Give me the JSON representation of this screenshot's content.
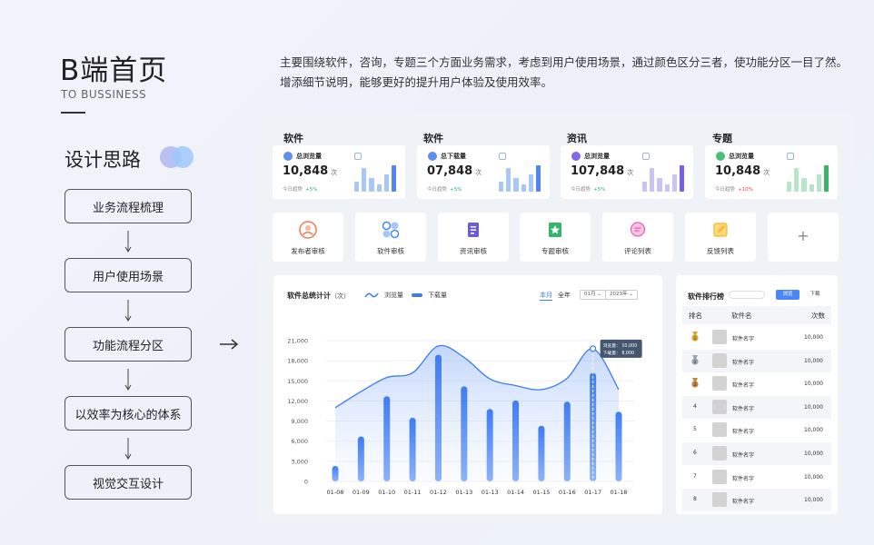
{
  "header": {
    "title": "B端首页",
    "subtitle": "TO BUSSINESS",
    "intro": "主要围绕软件，咨询，专题三个方面业务需求，考虑到用户使用场景，通过颜色区分三者，使功能分区一目了然。增添细节说明，能够更好的提升用户体验及使用效率。"
  },
  "flow": {
    "title": "设计思路",
    "steps": [
      "业务流程梳理",
      "用户使用场景",
      "功能流程分区",
      "以效率为核心的体系",
      "视觉交互设计"
    ]
  },
  "stat_cards": [
    {
      "category": "软件",
      "label": "总浏览量",
      "value": "10,848",
      "unit": "次",
      "trend_label": "今日趋势",
      "change": "+5%",
      "change_color": "#2ab36a",
      "color": "#5b8ff0",
      "bar_color": "#a9c6fb",
      "bar_highlight": "#4f86f2",
      "icon": "eye-icon"
    },
    {
      "category": "软件",
      "label": "总下载量",
      "value": "07,848",
      "unit": "次",
      "trend_label": "今日趋势",
      "change": "+5%",
      "change_color": "#2ab36a",
      "color": "#5b8ff0",
      "bar_color": "#a9c6fb",
      "bar_highlight": "#4f86f2",
      "icon": "download-icon"
    },
    {
      "category": "资讯",
      "label": "总浏览量",
      "value": "107,848",
      "unit": "次",
      "trend_label": "今日趋势",
      "change": "+5%",
      "change_color": "#2ab36a",
      "color": "#7f6be6",
      "bar_color": "#cbc2f5",
      "bar_highlight": "#7363e2",
      "icon": "eye-icon"
    },
    {
      "category": "专题",
      "label": "总浏览量",
      "value": "10,848",
      "unit": "次",
      "trend_label": "今日趋势",
      "change": "+10%",
      "change_color": "#e9473f",
      "color": "#48c07a",
      "bar_color": "#b6e6c7",
      "bar_highlight": "#37b36a",
      "icon": "eye-icon"
    }
  ],
  "tiles": [
    {
      "label": "发布者审核",
      "icon": "user-icon",
      "color": "#f07a4f"
    },
    {
      "label": "软件审核",
      "icon": "apps-icon",
      "color": "#4b87f5"
    },
    {
      "label": "资讯审核",
      "icon": "document-icon",
      "color": "#6a5ce0"
    },
    {
      "label": "专题审核",
      "icon": "star-icon",
      "color": "#35b56b"
    },
    {
      "label": "评论列表",
      "icon": "comment-icon",
      "color": "#e95fb2"
    },
    {
      "label": "反馈列表",
      "icon": "edit-icon",
      "color": "#f5b82e"
    },
    {
      "label": "+",
      "icon": "plus-icon",
      "color": "#888888"
    }
  ],
  "chart": {
    "title": "软件总统计计",
    "unit": "（次）",
    "legend_line": "浏览量",
    "legend_bar": "下载量",
    "tab_active": "本月",
    "tab_other": "全年",
    "month_select": "01月",
    "year_select": "2023年",
    "tooltip_line1": "浏览量：  10,000",
    "tooltip_line2": "下载量：   8,000"
  },
  "chart_data": {
    "type": "bar",
    "title": "软件总统计计（次）",
    "categories": [
      "01-08",
      "01-09",
      "01-10",
      "01-11",
      "01-12",
      "01-13",
      "01-13",
      "01-14",
      "01-15",
      "01-16",
      "01-17",
      "01-18"
    ],
    "yticks": [
      "0",
      "3,000",
      "6,000",
      "9,000",
      "12,000",
      "15,000",
      "18,000",
      "21,000"
    ],
    "ylim": [
      0,
      21000
    ],
    "grid": true,
    "series": [
      {
        "name": "下载量",
        "type": "bar",
        "values": [
          2300,
          6700,
          12700,
          9500,
          18900,
          14200,
          10800,
          12100,
          8300,
          11900,
          16200,
          10400
        ]
      },
      {
        "name": "浏览量",
        "type": "line",
        "values": [
          11000,
          13400,
          15500,
          16200,
          20200,
          18500,
          15300,
          14300,
          13700,
          15400,
          19800,
          13700
        ]
      }
    ]
  },
  "ranking": {
    "title": "软件排行榜",
    "btn_active": "浏览",
    "btn_other": "下载",
    "col_rank": "排名",
    "col_name": "软件名",
    "col_count": "次数",
    "rows": [
      {
        "rank": "1",
        "name": "软件名字",
        "count": "10,000"
      },
      {
        "rank": "2",
        "name": "软件名字",
        "count": "10,000"
      },
      {
        "rank": "3",
        "name": "软件名字",
        "count": "10,000"
      },
      {
        "rank": "4",
        "name": "软件名字",
        "count": "10,000"
      },
      {
        "rank": "5",
        "name": "软件名字",
        "count": "10,000"
      },
      {
        "rank": "6",
        "name": "软件名字",
        "count": "10,000"
      },
      {
        "rank": "7",
        "name": "软件名字",
        "count": "10,000"
      },
      {
        "rank": "8",
        "name": "软件名字",
        "count": "10,000"
      }
    ]
  }
}
